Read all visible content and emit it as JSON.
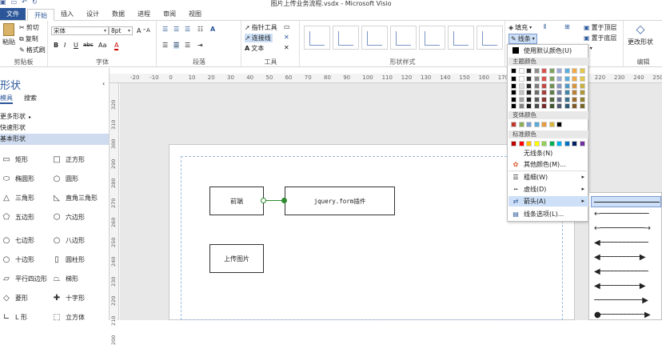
{
  "app": {
    "window_title": "图片上传业务流程.vsdx - Microsoft Visio"
  },
  "tabs": [
    "文件",
    "开始",
    "插入",
    "设计",
    "数据",
    "进程",
    "审阅",
    "视图"
  ],
  "ribbon": {
    "clipboard": {
      "paste": "粘贴",
      "cut": "剪切",
      "copy": "复制",
      "format_painter": "格式刷",
      "label": "剪贴板"
    },
    "font": {
      "name": "宋体",
      "size": "8pt",
      "bold": "B",
      "italic": "I",
      "underline": "U",
      "strike": "abc",
      "aa": "Aa",
      "grow": "A",
      "shrink": "A",
      "color_a": "A",
      "label": "字体"
    },
    "paragraph": {
      "label": "段落"
    },
    "tools": {
      "pointer": "指针工具",
      "connector": "连接线",
      "text": "文本",
      "label": "工具"
    },
    "shape_styles": {
      "label": "形状样式",
      "fill": "填充",
      "line": "线条"
    },
    "arrange": {
      "bring_front": "置于顶层",
      "send_back": "置于底层",
      "change_shape": "更改形状",
      "edit": "编辑"
    }
  },
  "shapes_panel": {
    "title": "形状",
    "tab_stencils": "模具",
    "tab_search": "搜索",
    "stencils": [
      "更多形状",
      "快速形状",
      "基本形状"
    ],
    "selected_stencil": "基本形状",
    "items": [
      {
        "icon": "rectangle",
        "label": "矩形"
      },
      {
        "icon": "square",
        "label": "正方形"
      },
      {
        "icon": "ellipse",
        "label": "椭圆形"
      },
      {
        "icon": "circle",
        "label": "圆形"
      },
      {
        "icon": "triangle",
        "label": "三角形"
      },
      {
        "icon": "right-triangle",
        "label": "直角三角形"
      },
      {
        "icon": "pentagon",
        "label": "五边形"
      },
      {
        "icon": "hexagon",
        "label": "六边形"
      },
      {
        "icon": "heptagon",
        "label": "七边形"
      },
      {
        "icon": "octagon",
        "label": "八边形"
      },
      {
        "icon": "decagon",
        "label": "十边形"
      },
      {
        "icon": "cylinder",
        "label": "圆柱形"
      },
      {
        "icon": "parallelogram",
        "label": "平行四边形"
      },
      {
        "icon": "trapezoid",
        "label": "梯形"
      },
      {
        "icon": "diamond",
        "label": "菱形"
      },
      {
        "icon": "cross",
        "label": "十字形"
      },
      {
        "icon": "l-shape",
        "label": "L 形"
      },
      {
        "icon": "cube",
        "label": "立方体"
      }
    ]
  },
  "ruler": {
    "top_ticks": [
      "-20",
      "-10",
      "0",
      "10",
      "20",
      "30",
      "40",
      "50",
      "60",
      "70",
      "80",
      "90",
      "100",
      "110",
      "120",
      "130",
      "140",
      "150",
      "160",
      "170",
      "180",
      "190",
      "200",
      "210",
      "220",
      "230",
      "240",
      "250"
    ],
    "left_ticks": [
      "320",
      "310",
      "300",
      "290",
      "280",
      "270",
      "260",
      "250",
      "240",
      "230",
      "220",
      "210",
      "200"
    ]
  },
  "diagram": {
    "boxes": [
      "前端",
      "jquery.form插件",
      "上传图片"
    ]
  },
  "line_menu": {
    "default_color": "使用默认颜色(U)",
    "theme_colors_label": "主题颜色",
    "variant_colors_label": "变体颜色",
    "standard_colors_label": "标准颜色",
    "no_line": "无线条(N)",
    "more_colors": "其他颜色(M)...",
    "weight": "粗细(W)",
    "dash": "虚线(D)",
    "arrows": "箭头(A)",
    "line_options": "线条选项(L)...",
    "theme_colors": [
      "#000000",
      "#ffffff",
      "#2e2e2e",
      "#8e8e8e",
      "#d9534f",
      "#7fa35f",
      "#9aa9d6",
      "#5aaedc",
      "#f2a94a",
      "#e3c74b"
    ],
    "variant_colors": [
      "#c0392b",
      "#8cae5a",
      "#7e9cd1",
      "#5aa9d6",
      "#e89a3c",
      "#d7b53b",
      "#000000"
    ],
    "standard_colors": [
      "#c00000",
      "#ff0000",
      "#ffc000",
      "#ffff00",
      "#92d050",
      "#00b050",
      "#00b0f0",
      "#0070c0",
      "#002060",
      "#7030a0"
    ]
  }
}
